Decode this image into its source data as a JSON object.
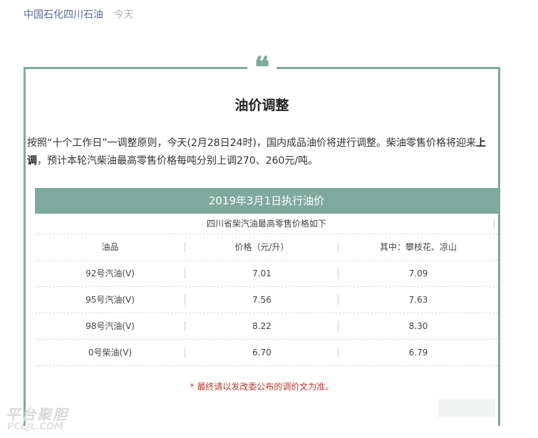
{
  "header": {
    "author": "中国石化四川石油",
    "date": "今天"
  },
  "card": {
    "title": "油价调整",
    "intro_before": "按照“十个工作日”一调整原则，今天(2月28日24时)，国内成品油价将进行调整。柴油零售价格将迎来",
    "intro_bold": "上调",
    "intro_after": "，预计本轮汽柴油最高零售价格每吨分别上调270、260元/吨。"
  },
  "table": {
    "title": "2019年3月1日执行油价",
    "subtitle": "四川省柴汽油最高零售价格如下",
    "columns": [
      "油品",
      "价格（元/升）",
      "其中：攀枝花、凉山"
    ],
    "rows": [
      [
        "92号汽油(V)",
        "7.01",
        "7.09"
      ],
      [
        "95号汽油(V)",
        "7.56",
        "7.63"
      ],
      [
        "98号汽油(V)",
        "8.22",
        "8.30"
      ],
      [
        "0号柴油(V)",
        "6.70",
        "6.79"
      ]
    ],
    "note": "* 最终请以发改委公布的调价文为准。"
  },
  "watermark": {
    "main": "平台聚胆",
    "sub": "PCLJL.COM"
  },
  "colors": {
    "accent": "#7fa99d",
    "link": "#576b95",
    "note": "#c0392b"
  }
}
